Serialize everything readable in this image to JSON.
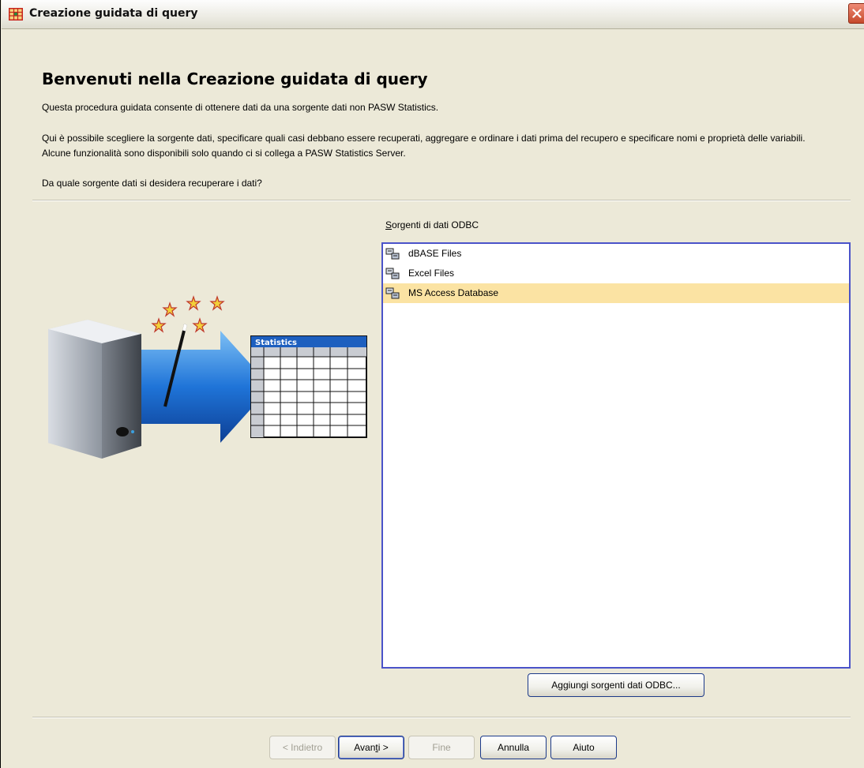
{
  "window": {
    "title": "Creazione guidata di query",
    "accent": "#4a53c9"
  },
  "content": {
    "heading": "Benvenuti nella Creazione guidata di query",
    "intro": "Questa procedura guidata consente di ottenere dati da una sorgente dati non PASW Statistics.",
    "description": "Qui è possibile scegliere la sorgente dati, specificare quali casi debbano essere recuperati, aggregare e ordinare i dati prima del recupero e specificare nomi e proprietà delle variabili. Alcune funzionalità sono disponibili solo quando ci si collega a PASW Statistics Server.",
    "question": "Da quale sorgente dati si desidera recuperare i dati?"
  },
  "illustration": {
    "table_caption": "Statistics"
  },
  "datasources": {
    "label_prefix": "S",
    "label_rest": "orgenti di dati ODBC",
    "items": [
      {
        "label": "dBASE Files",
        "selected": false
      },
      {
        "label": "Excel Files",
        "selected": false
      },
      {
        "label": "MS Access Database",
        "selected": true
      }
    ],
    "selected_color": "#fbe3a3"
  },
  "buttons": {
    "add_prefix": "A",
    "add_mnemonic": "g",
    "add_rest": "giungi sorgenti dati ODBC...",
    "back": "< Indietro",
    "next_prefix": "Avan",
    "next_mnemonic": "t",
    "next_rest": "i >",
    "finish": "Fine",
    "cancel": "Annulla",
    "help": "Aiuto"
  }
}
